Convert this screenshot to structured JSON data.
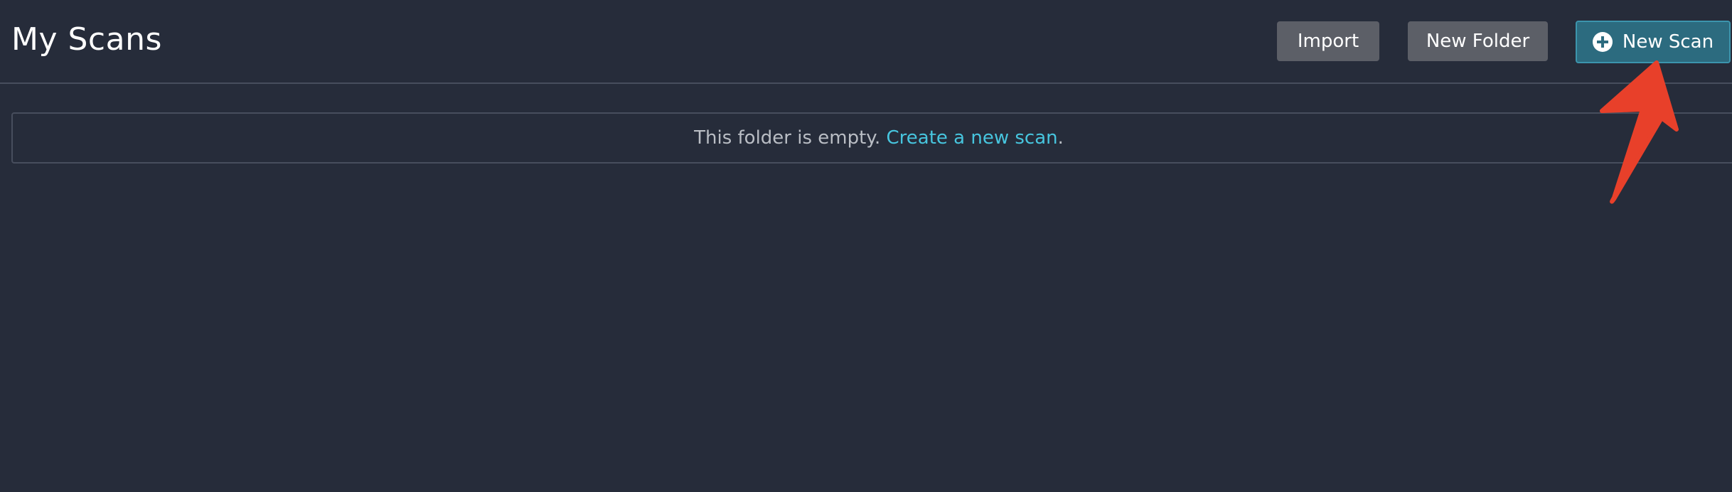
{
  "header": {
    "title": "My Scans",
    "import_label": "Import",
    "new_folder_label": "New Folder",
    "new_scan_label": "New Scan",
    "new_scan_icon": "plus-circle-icon"
  },
  "empty_state": {
    "message": "This folder is empty.",
    "link_text": "Create a new scan",
    "suffix": "."
  },
  "colors": {
    "background": "#262c3a",
    "button_gray": "#5c5f67",
    "button_primary": "#2c6b7f",
    "link": "#47c5de",
    "annotation_arrow": "#e8402a"
  }
}
